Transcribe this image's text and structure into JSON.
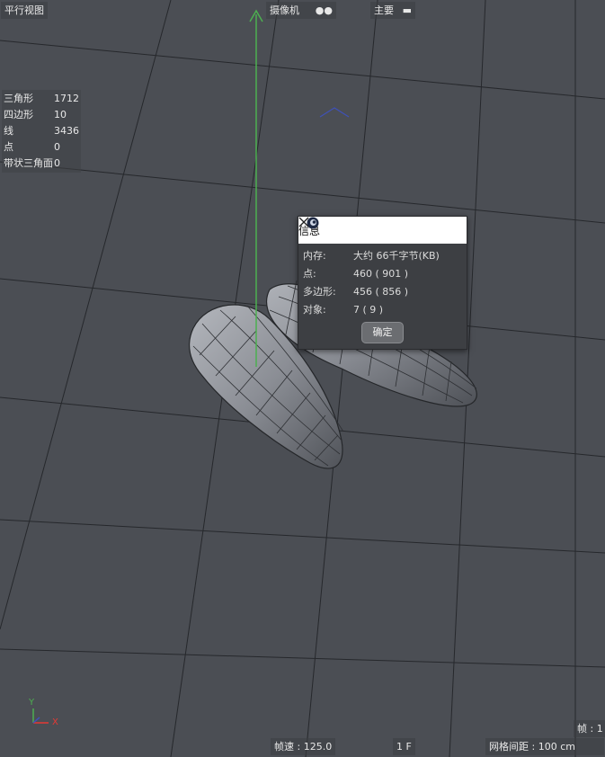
{
  "viewport": {
    "view_label": "平行视图",
    "camera_label": "摄像机",
    "render_label": "主要"
  },
  "stats": [
    {
      "label": "三角形",
      "value": "1712"
    },
    {
      "label": "四边形",
      "value": "10"
    },
    {
      "label": "线",
      "value": "3436"
    },
    {
      "label": "点",
      "value": "0"
    },
    {
      "label": "带状三角面",
      "value": "0"
    }
  ],
  "dialog": {
    "title": "信息",
    "rows": [
      {
        "label": "内存:",
        "value": "大约 66千字节(KB)"
      },
      {
        "label": "点:",
        "value": "460 ( 901 )"
      },
      {
        "label": "多边形:",
        "value": "456 ( 856 )"
      },
      {
        "label": "对象:",
        "value": "7 ( 9 )"
      }
    ],
    "ok_label": "确定"
  },
  "axes": {
    "y": "Y",
    "x": "X"
  },
  "status": {
    "fps": "帧速 : 125.0",
    "frame": "1 F",
    "frame_right": "帧 : 1",
    "grid": "网格间距 : 100 cm"
  },
  "colors": {
    "background": "#4b4e54",
    "grid_line": "#26282c",
    "y_axis": "#4caf50",
    "x_axis": "#e53935",
    "z_axis": "#3f51b5",
    "mesh": "#8f9299"
  }
}
